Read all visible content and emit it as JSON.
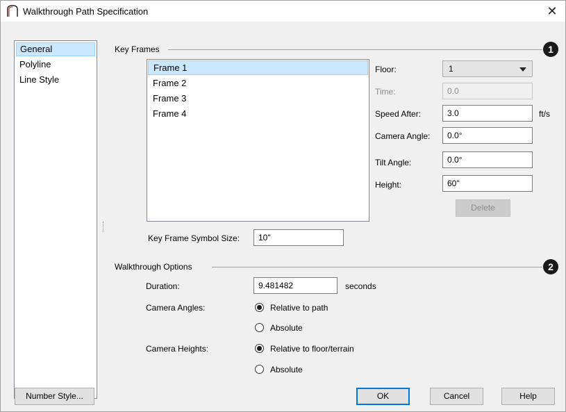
{
  "window": {
    "title": "Walkthrough Path Specification",
    "close_glyph": "✕"
  },
  "sidebar": {
    "items": [
      {
        "label": "General",
        "selected": true
      },
      {
        "label": "Polyline",
        "selected": false
      },
      {
        "label": "Line Style",
        "selected": false
      }
    ]
  },
  "key_frames": {
    "title": "Key Frames",
    "badge": "1",
    "frames": [
      "Frame 1",
      "Frame 2",
      "Frame 3",
      "Frame 4"
    ],
    "selected_index": 0,
    "floor_label": "Floor:",
    "floor_value": "1",
    "time_label": "Time:",
    "time_value": "0.0",
    "speed_label": "Speed After:",
    "speed_value": "3.0",
    "speed_unit": "ft/s",
    "camera_angle_label": "Camera Angle:",
    "camera_angle_value": "0.0°",
    "tilt_angle_label": "Tilt Angle:",
    "tilt_angle_value": "0.0°",
    "height_label": "Height:",
    "height_value": "60\"",
    "delete_label": "Delete",
    "symbol_size_label": "Key Frame Symbol Size:",
    "symbol_size_value": "10\""
  },
  "walkthrough_options": {
    "title": "Walkthrough Options",
    "badge": "2",
    "duration_label": "Duration:",
    "duration_value": "9.481482",
    "duration_unit": "seconds",
    "camera_angles_label": "Camera Angles:",
    "camera_angles_options": [
      "Relative to path",
      "Absolute"
    ],
    "camera_angles_selected": 0,
    "camera_heights_label": "Camera Heights:",
    "camera_heights_options": [
      "Relative to floor/terrain",
      "Absolute"
    ],
    "camera_heights_selected": 0
  },
  "footer": {
    "number_style_label": "Number Style...",
    "ok_label": "OK",
    "cancel_label": "Cancel",
    "help_label": "Help"
  }
}
